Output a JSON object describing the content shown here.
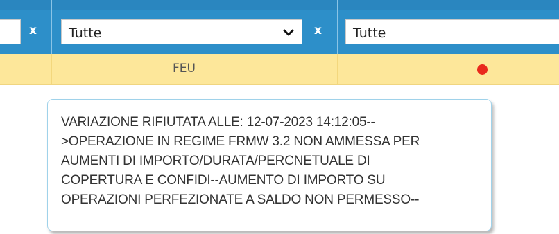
{
  "filters": {
    "clear_label": "x",
    "select_1": {
      "value": "Tutte"
    },
    "select_2": {
      "value": "Tutte"
    }
  },
  "row": {
    "type_value": "FEU",
    "status_color": "#e9291c"
  },
  "tooltip": {
    "lines": [
      "VARIAZIONE RIFIUTATA ALLE: 12-07-2023 14:12:05--",
      ">OPERAZIONE IN REGIME FRMW 3.2 NON AMMESSA PER",
      "AUMENTI DI IMPORTO/DURATA/PERCNETUALE DI",
      "COPERTURA E CONFIDI--AUMENTO DI IMPORTO SU",
      "OPERAZIONI PERFEZIONATE A SALDO NON PERMESSO--"
    ]
  },
  "colors": {
    "header_blue": "#2d8fc9",
    "row_yellow": "#fde79a",
    "tooltip_border": "#9fd2ea"
  }
}
